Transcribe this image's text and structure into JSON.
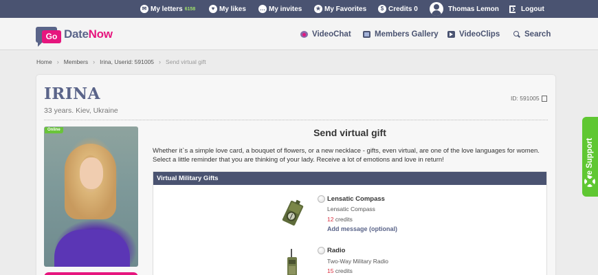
{
  "topbar": {
    "letters_label": "My letters",
    "letters_count": "6158",
    "likes_label": "My likes",
    "invites_label": "My invites",
    "favorites_label": "My Favorites",
    "credits_label": "Credits 0",
    "user_name": "Thomas Lemon",
    "logout_label": "Logout"
  },
  "header": {
    "logo_go": "Go",
    "logo_date": "Date",
    "logo_now": "Now",
    "nav": {
      "videochat": "VideoChat",
      "gallery": "Members Gallery",
      "clips": "VideoClips",
      "search": "Search"
    }
  },
  "breadcrumb": {
    "home": "Home",
    "members": "Members",
    "member": "Irina, Userid: 591005",
    "current": "Send virtual gift"
  },
  "profile": {
    "name": "IRINA",
    "subtitle": "33 years. Kiev, Ukraine",
    "id_text": "ID: 591005",
    "online_badge": "Online"
  },
  "gift_page": {
    "title": "Send virtual gift",
    "description": "Whether it`s a simple love card, a bouquet of flowers, or a new necklace - gifts, even virtual, are one of the love languages for women. Select a little reminder that you are thinking of your lady. Receive a lot of emotions and love in return!",
    "category": "Virtual Military Gifts",
    "items": [
      {
        "name": "Lensatic Compass",
        "desc": "Lensatic Compass",
        "credits_num": "12",
        "credits_word": "credits",
        "add_message": "Add message (optional)"
      },
      {
        "name": "Radio",
        "desc": "Two-Way Military Radio",
        "credits_num": "15",
        "credits_word": "credits"
      }
    ]
  },
  "live_support": {
    "label": "Live Support"
  },
  "colors": {
    "topbar": "#4a5371",
    "brand_pink": "#e6167e",
    "online_green": "#6ac43a",
    "support_green": "#5fc732",
    "credits_red": "#d92a3a"
  }
}
